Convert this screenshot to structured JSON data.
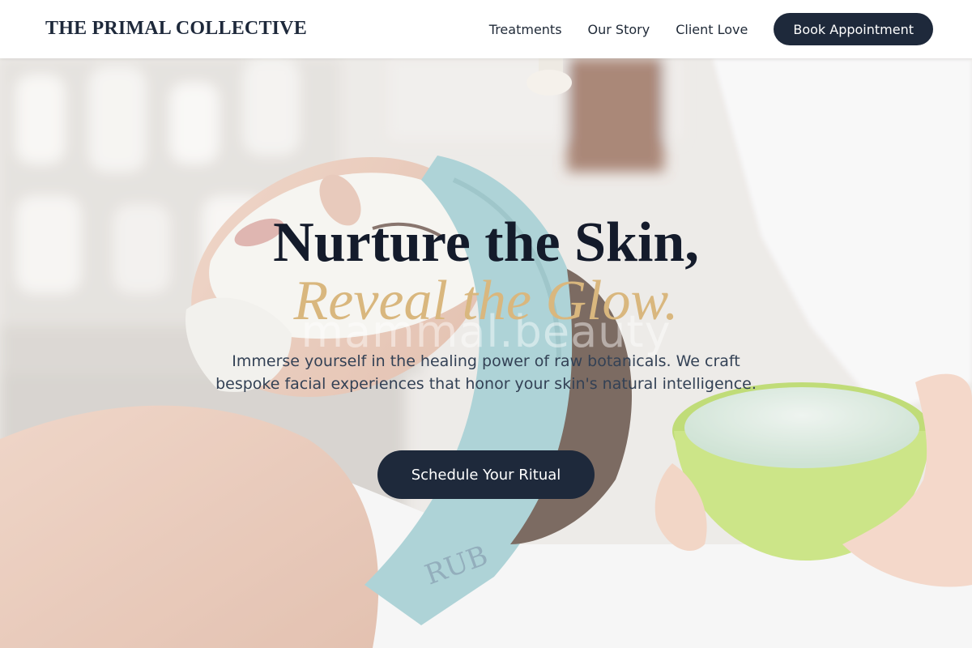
{
  "header": {
    "brand": "THE PRIMAL COLLECTIVE",
    "nav": [
      "Treatments",
      "Our Story",
      "Client Love"
    ],
    "book_label": "Book Appointment"
  },
  "hero": {
    "title_line1": "Nurture the Skin,",
    "title_line2": "Reveal the Glow.",
    "watermark": "mammal.beauty",
    "subtitle": "Immerse yourself in the healing power of raw botanicals. We craft bespoke facial experiences that honor your skin's natural intelligence.",
    "cta_label": "Schedule Your Ritual",
    "image_subject": "woman receiving facial mask treatment with green bowl"
  },
  "colors": {
    "primary": "#1e293b",
    "accent_gold": "#d9b77e",
    "headband": "#8fc3c8",
    "bowl": "#b9dc5a"
  }
}
